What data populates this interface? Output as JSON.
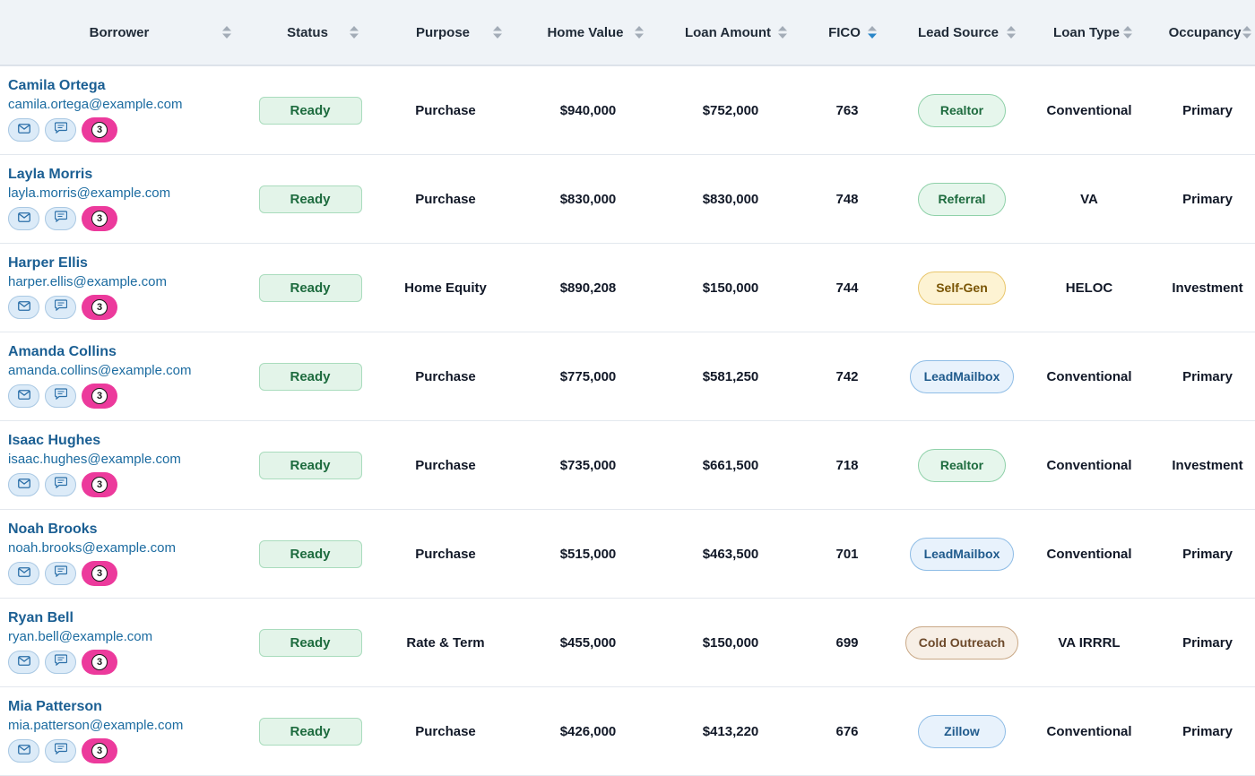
{
  "columns": [
    {
      "label": "Borrower",
      "sort": "none"
    },
    {
      "label": "Status",
      "sort": "none"
    },
    {
      "label": "Purpose",
      "sort": "none"
    },
    {
      "label": "Home Value",
      "sort": "none"
    },
    {
      "label": "Loan Amount",
      "sort": "none"
    },
    {
      "label": "FICO",
      "sort": "desc"
    },
    {
      "label": "Lead Source",
      "sort": "none"
    },
    {
      "label": "Loan Type",
      "sort": "none"
    },
    {
      "label": "Occupancy",
      "sort": "none"
    }
  ],
  "colors": {
    "sort_active": "#2a86c8",
    "sort_inactive": "#a3acb7",
    "badge_pink": "#ec3a9c"
  },
  "icons": {
    "email": "email-icon",
    "sms": "sms-icon",
    "count": "badge-count-icon"
  },
  "rows": [
    {
      "name": "Camila Ortega",
      "email": "camila.ortega@example.com",
      "count": "3",
      "status": "Ready",
      "purpose": "Purchase",
      "home_value": "$940,000",
      "loan_amount": "$752,000",
      "fico": "763",
      "lead_source": "Realtor",
      "lead_color": "green",
      "loan_type": "Conventional",
      "occupancy": "Primary"
    },
    {
      "name": "Layla Morris",
      "email": "layla.morris@example.com",
      "count": "3",
      "status": "Ready",
      "purpose": "Purchase",
      "home_value": "$830,000",
      "loan_amount": "$830,000",
      "fico": "748",
      "lead_source": "Referral",
      "lead_color": "green",
      "loan_type": "VA",
      "occupancy": "Primary"
    },
    {
      "name": "Harper Ellis",
      "email": "harper.ellis@example.com",
      "count": "3",
      "status": "Ready",
      "purpose": "Home Equity",
      "home_value": "$890,208",
      "loan_amount": "$150,000",
      "fico": "744",
      "lead_source": "Self-Gen",
      "lead_color": "yellow",
      "loan_type": "HELOC",
      "occupancy": "Investment"
    },
    {
      "name": "Amanda Collins",
      "email": "amanda.collins@example.com",
      "count": "3",
      "status": "Ready",
      "purpose": "Purchase",
      "home_value": "$775,000",
      "loan_amount": "$581,250",
      "fico": "742",
      "lead_source": "LeadMailbox",
      "lead_color": "blue",
      "loan_type": "Conventional",
      "occupancy": "Primary"
    },
    {
      "name": "Isaac Hughes",
      "email": "isaac.hughes@example.com",
      "count": "3",
      "status": "Ready",
      "purpose": "Purchase",
      "home_value": "$735,000",
      "loan_amount": "$661,500",
      "fico": "718",
      "lead_source": "Realtor",
      "lead_color": "green",
      "loan_type": "Conventional",
      "occupancy": "Investment"
    },
    {
      "name": "Noah Brooks",
      "email": "noah.brooks@example.com",
      "count": "3",
      "status": "Ready",
      "purpose": "Purchase",
      "home_value": "$515,000",
      "loan_amount": "$463,500",
      "fico": "701",
      "lead_source": "LeadMailbox",
      "lead_color": "blue",
      "loan_type": "Conventional",
      "occupancy": "Primary"
    },
    {
      "name": "Ryan Bell",
      "email": "ryan.bell@example.com",
      "count": "3",
      "status": "Ready",
      "purpose": "Rate & Term",
      "home_value": "$455,000",
      "loan_amount": "$150,000",
      "fico": "699",
      "lead_source": "Cold Outreach",
      "lead_color": "brown",
      "loan_type": "VA IRRRL",
      "occupancy": "Primary"
    },
    {
      "name": "Mia Patterson",
      "email": "mia.patterson@example.com",
      "count": "3",
      "status": "Ready",
      "purpose": "Purchase",
      "home_value": "$426,000",
      "loan_amount": "$413,220",
      "fico": "676",
      "lead_source": "Zillow",
      "lead_color": "blue",
      "loan_type": "Conventional",
      "occupancy": "Primary"
    }
  ]
}
